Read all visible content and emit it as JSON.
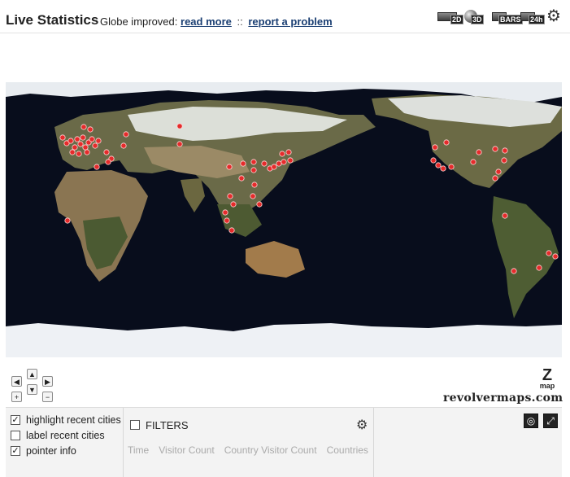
{
  "header": {
    "title": "Live Statistics",
    "notice_prefix": "Globe improved:",
    "read_more": "read more",
    "separator": "::",
    "report": "report a problem"
  },
  "view_buttons": [
    {
      "id": "2d",
      "label": "2D",
      "icon": "map-2d-icon"
    },
    {
      "id": "3d",
      "label": "3D",
      "icon": "globe-3d-icon"
    },
    {
      "id": "bars",
      "label": "BARS",
      "icon": "bars-icon"
    },
    {
      "id": "24h",
      "label": "24h",
      "icon": "clock-24h-icon"
    }
  ],
  "brand": "revolvermaps.com",
  "zmap": {
    "letter": "Z",
    "label": "map"
  },
  "options": [
    {
      "label": "highlight recent cities",
      "checked": true
    },
    {
      "label": "label recent cities",
      "checked": false
    },
    {
      "label": "pointer info",
      "checked": true
    }
  ],
  "filters": {
    "label": "FILTERS",
    "checked": false,
    "columns": [
      "Time",
      "Visitor Count",
      "Country Visitor Count",
      "Countries"
    ]
  },
  "colors": {
    "ocean": "#080d1c",
    "dot": "#e52b2b",
    "link": "#1b3f73"
  }
}
